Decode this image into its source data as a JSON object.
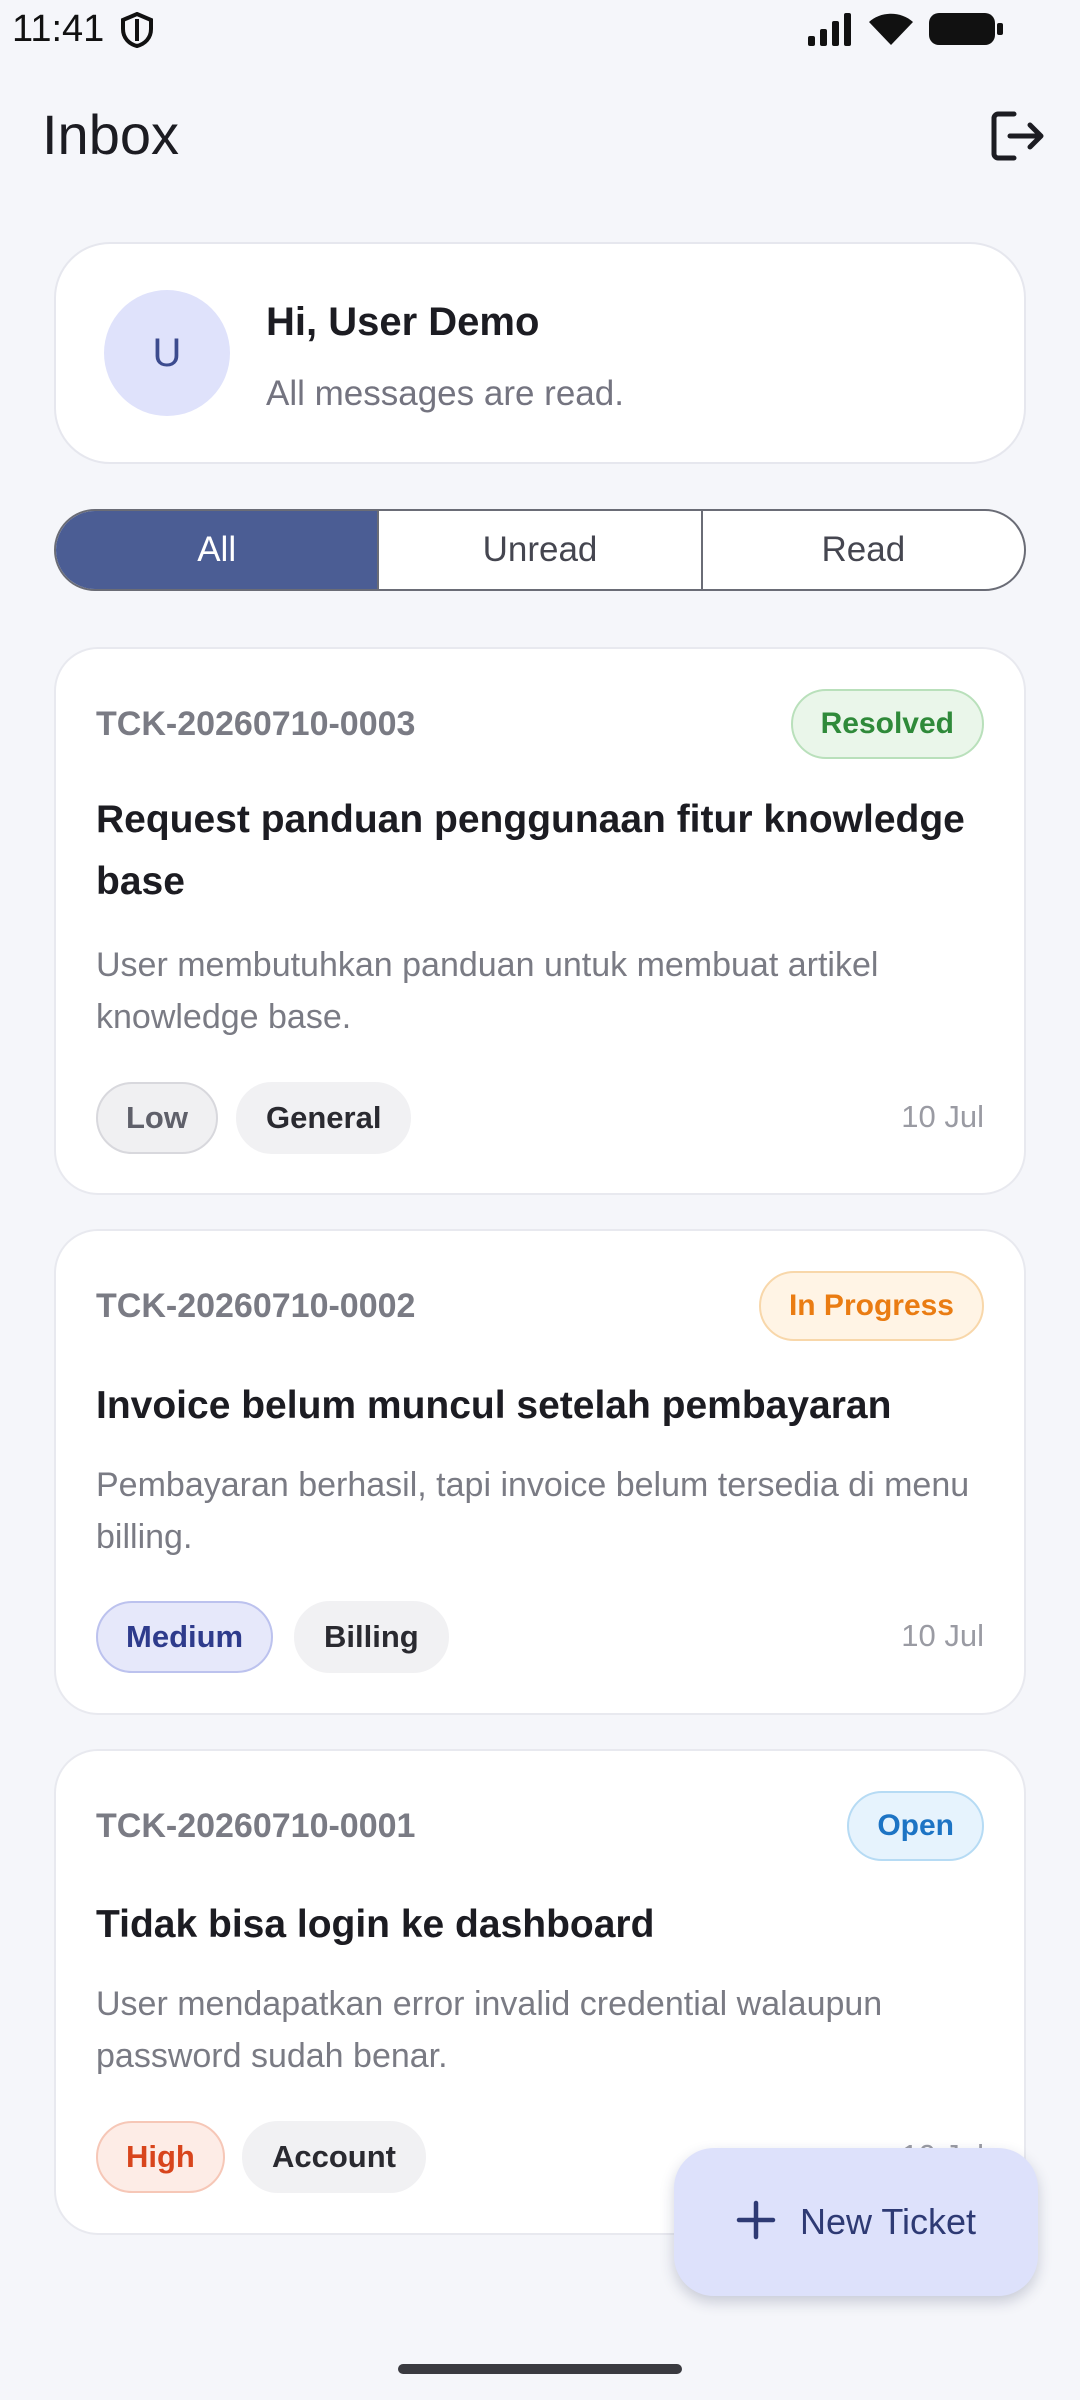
{
  "status_bar": {
    "time": "11:41"
  },
  "app_bar": {
    "title": "Inbox"
  },
  "profile": {
    "avatar_initial": "U",
    "greeting": "Hi, User Demo",
    "subtitle": "All messages are read."
  },
  "filters": [
    {
      "label": "All",
      "active": true
    },
    {
      "label": "Unread",
      "active": false
    },
    {
      "label": "Read",
      "active": false
    }
  ],
  "tickets": [
    {
      "id": "TCK-20260710-0003",
      "status": "Resolved",
      "title": "Request panduan penggunaan fitur knowledge base",
      "description": "User membutuhkan panduan untuk membuat artikel knowledge base.",
      "priority": "Low",
      "category": "General",
      "date": "10 Jul"
    },
    {
      "id": "TCK-20260710-0002",
      "status": "In Progress",
      "title": "Invoice belum muncul setelah pembayaran",
      "description": "Pembayaran berhasil, tapi invoice belum tersedia di menu billing.",
      "priority": "Medium",
      "category": "Billing",
      "date": "10 Jul"
    },
    {
      "id": "TCK-20260710-0001",
      "status": "Open",
      "title": "Tidak bisa login ke dashboard",
      "description": "User mendapatkan error invalid credential walaupun password sudah benar.",
      "priority": "High",
      "category": "Account",
      "date": "10 Jul"
    }
  ],
  "fab": {
    "label": "New Ticket"
  },
  "colors": {
    "accent": "#4b5d94",
    "resolved": "#2f8a3a",
    "in_progress": "#ea7c12",
    "open": "#1d74c4",
    "high": "#d8451c",
    "medium": "#2e3b8c"
  }
}
